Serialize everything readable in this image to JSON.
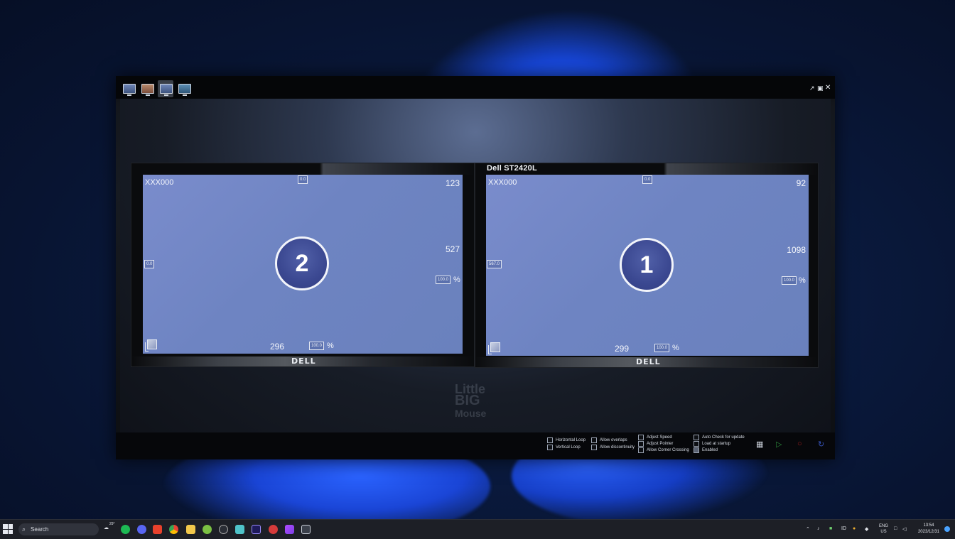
{
  "app": {
    "watermark_line1": "Little",
    "watermark_line2": "BIG",
    "watermark_line3": "Mouse",
    "window_controls": [
      "pin-icon",
      "restore-icon",
      "close-icon"
    ]
  },
  "monitors": [
    {
      "title": "",
      "brand": "DELL",
      "screen_name": "XXX000",
      "badge": "2",
      "top_value": "0.0",
      "left_value": "0.0",
      "width_px": "123",
      "height_px": "527",
      "bottom_px": "296",
      "scale_v": "100.0",
      "scale_h": "100.0",
      "percent": "%"
    },
    {
      "title": "Dell ST2420L",
      "brand": "DELL",
      "screen_name": "XXX000",
      "badge": "1",
      "top_value": "0.0",
      "left_value": "567.0",
      "width_px": "92",
      "height_px": "1098",
      "bottom_px": "299",
      "scale_v": "100.0",
      "scale_h": "100.0",
      "percent": "%"
    }
  ],
  "options": {
    "horizontal_loop": "Horizontal Loop",
    "vertical_loop": "Vertical Loop",
    "allow_overlaps": "Allow overlaps",
    "allow_discontinuity": "Allow discontinuity",
    "adjust_speed": "Adjust Speed",
    "adjust_pointer": "Adjust Pointer",
    "allow_corner_crossing": "Allow Corner Crossing",
    "auto_check_update": "Auto Check for update",
    "load_at_startup": "Load at startup",
    "enabled": "Enabled"
  },
  "taskbar": {
    "search_placeholder": "Search",
    "weather_temp": "29°",
    "language_top": "ENG",
    "language_bottom": "US",
    "time": "13:54",
    "date": "2023/12/31",
    "ime": "ID"
  }
}
